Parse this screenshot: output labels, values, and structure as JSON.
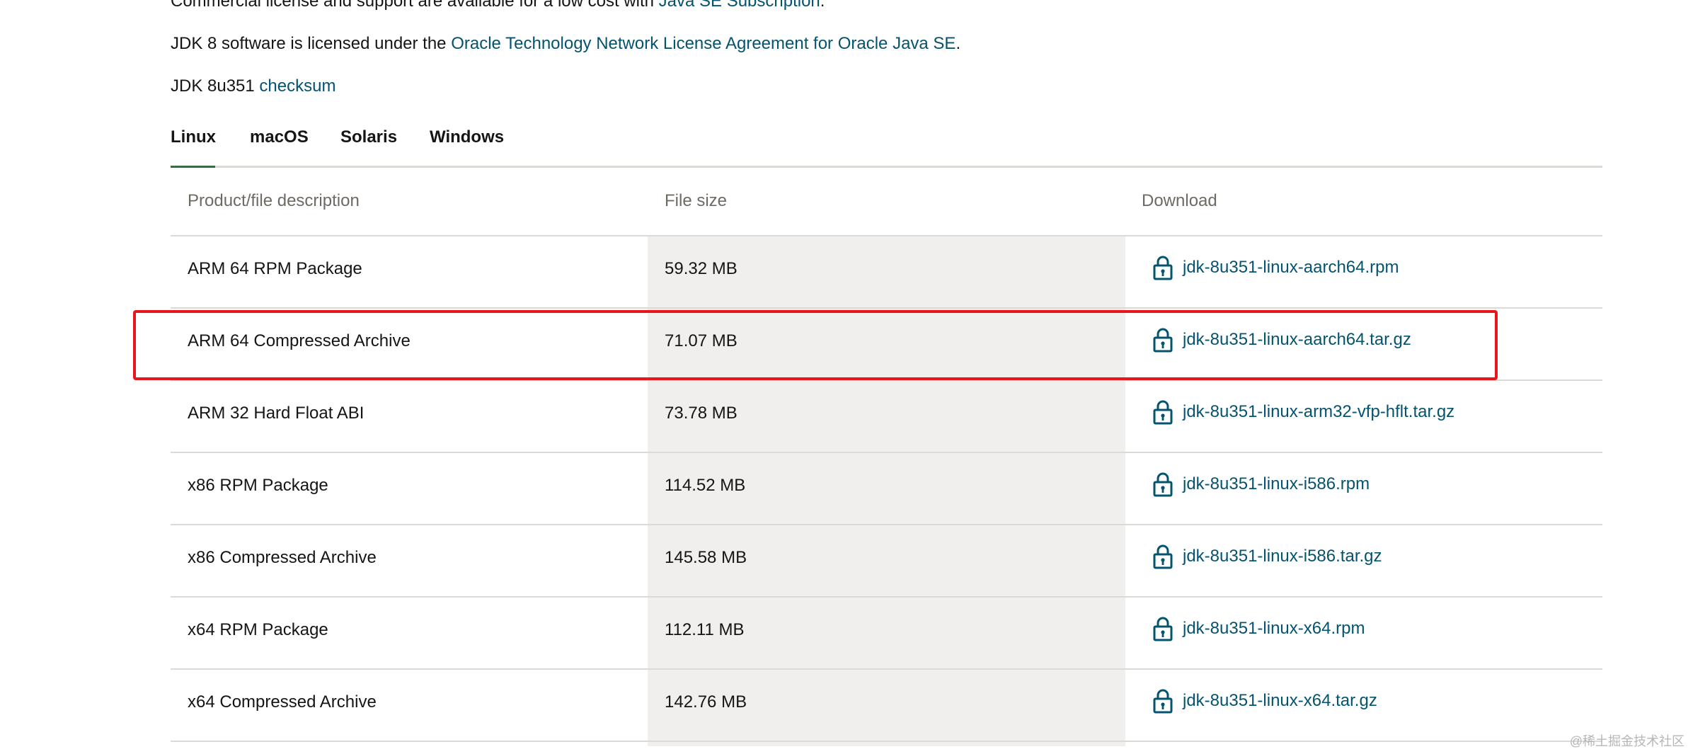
{
  "intro": {
    "line1_text": "Commercial license and support are available for a low cost with ",
    "line1_link": "Java SE Subscription",
    "line1_end": ".",
    "line2_text": "JDK 8 software is licensed under the ",
    "line2_link": "Oracle Technology Network License Agreement for Oracle Java SE",
    "line2_end": ".",
    "line3_text": "JDK 8u351 ",
    "line3_link": "checksum"
  },
  "tabs": [
    {
      "label": "Linux",
      "active": true
    },
    {
      "label": "macOS",
      "active": false
    },
    {
      "label": "Solaris",
      "active": false
    },
    {
      "label": "Windows",
      "active": false
    }
  ],
  "table": {
    "headers": [
      "Product/file description",
      "File size",
      "Download"
    ],
    "rows": [
      {
        "description": "ARM 64 RPM Package",
        "size": "59.32 MB",
        "file": "jdk-8u351-linux-aarch64.rpm"
      },
      {
        "description": "ARM 64 Compressed Archive",
        "size": "71.07 MB",
        "file": "jdk-8u351-linux-aarch64.tar.gz"
      },
      {
        "description": "ARM 32 Hard Float ABI",
        "size": "73.78 MB",
        "file": "jdk-8u351-linux-arm32-vfp-hflt.tar.gz"
      },
      {
        "description": "x86 RPM Package",
        "size": "114.52 MB",
        "file": "jdk-8u351-linux-i586.rpm"
      },
      {
        "description": "x86 Compressed Archive",
        "size": "145.58 MB",
        "file": "jdk-8u351-linux-i586.tar.gz"
      },
      {
        "description": "x64 RPM Package",
        "size": "112.11 MB",
        "file": "jdk-8u351-linux-x64.rpm"
      },
      {
        "description": "x64 Compressed Archive",
        "size": "142.76 MB",
        "file": "jdk-8u351-linux-x64.tar.gz"
      }
    ]
  },
  "highlighted_row": 1,
  "watermark": "@稀土掘金技术社区",
  "colors": {
    "link": "#04536f",
    "highlight_border": "#e8161a",
    "active_tab_underline": "#3a6b44",
    "column_shade": "#f1efed"
  },
  "icons": {
    "download": "lock-icon"
  }
}
